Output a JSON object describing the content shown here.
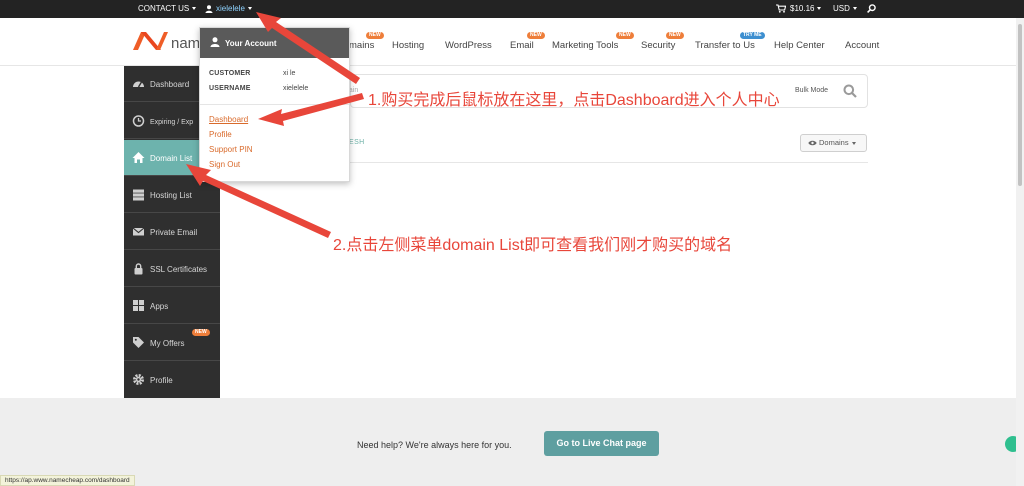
{
  "topbar": {
    "contact_us": "CONTACT US",
    "username": "xielelele",
    "cart_amount": "$10.16",
    "currency": "USD"
  },
  "header": {
    "logo_text": "name",
    "nav": [
      {
        "label": "mains",
        "badge": "NEW"
      },
      {
        "label": "Hosting",
        "badge": ""
      },
      {
        "label": "WordPress",
        "badge": ""
      },
      {
        "label": "Email",
        "badge": "NEW"
      },
      {
        "label": "Marketing Tools",
        "badge": "NEW"
      },
      {
        "label": "Security",
        "badge": "NEW"
      },
      {
        "label": "Transfer to Us",
        "badge": "TRY ME"
      },
      {
        "label": "Help Center",
        "badge": ""
      },
      {
        "label": "Account",
        "badge": ""
      }
    ]
  },
  "dropdown": {
    "title": "Your Account",
    "customer_label": "CUSTOMER",
    "customer_value": "xi le",
    "username_label": "USERNAME",
    "username_value": "xielelele",
    "links": [
      "Dashboard",
      "Profile",
      "Support PIN",
      "Sign Out"
    ]
  },
  "sidebar": {
    "items": [
      {
        "label": "Dashboard",
        "icon": "dashboard-icon",
        "badge": ""
      },
      {
        "label": "Expiring / Exp",
        "icon": "clock-icon",
        "badge": ""
      },
      {
        "label": "Domain List",
        "icon": "home-icon",
        "badge": ""
      },
      {
        "label": "Hosting List",
        "icon": "server-icon",
        "badge": ""
      },
      {
        "label": "Private Email",
        "icon": "envelope-icon",
        "badge": ""
      },
      {
        "label": "SSL Certificates",
        "icon": "lock-icon",
        "badge": ""
      },
      {
        "label": "Apps",
        "icon": "apps-icon",
        "badge": ""
      },
      {
        "label": "My Offers",
        "icon": "tag-icon",
        "badge": "NEW"
      },
      {
        "label": "Profile",
        "icon": "gear-icon",
        "badge": ""
      }
    ]
  },
  "main": {
    "search_left": "hain",
    "bulk_mode": "Bulk Mode",
    "refresh": "ESH",
    "domains_filter": "Domains"
  },
  "footer": {
    "help_text": "Need help? We're always here for you.",
    "chat_button": "Go to Live Chat page"
  },
  "status_url": "https://ap.www.namecheap.com/dashboard",
  "annotations": {
    "step1": "1.购买完成后鼠标放在这里，点击Dashboard进入个人中心",
    "step2": "2.点击左侧菜单domain List即可查看我们刚才购买的域名"
  },
  "colors": {
    "annotation_red": "#e8463a",
    "active_sidebar": "#6db3ad",
    "brand_orange": "#ef5d27",
    "link_orange": "#d96a2b"
  }
}
